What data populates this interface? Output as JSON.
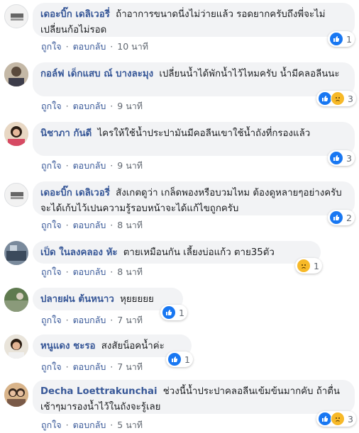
{
  "ui": {
    "like_label": "ถูกใจ",
    "reply_label": "ตอบกลับ",
    "separator": "·",
    "colors": {
      "author": "#385898",
      "bubble": "#f2f3f5",
      "meta": "#606770",
      "like": "#1877f2",
      "sad": "#f7b928"
    }
  },
  "comments": [
    {
      "author": "เดอะบิ๊ก เดลิเวอรี่",
      "text": "ถ้าอาการขนาดนี่งไม่ว่ายแล้ว รอดยากครับถึงพี่จะไม่เปลี่ยนก้อไม่รอด",
      "time": "10 นาที",
      "reactions": [
        "like-icon"
      ],
      "reaction_count": "1",
      "avatar": "brand-logo"
    },
    {
      "author": "กอล์ฟ เด็กแสบ ณ์ บางละมุง",
      "text": "เปลี่ยนน้ำได้พักน้ำไว้ไหมครับ น้ำมีคลอลีนนะ",
      "time": "9 นาที",
      "reactions": [
        "like-icon",
        "sad-icon"
      ],
      "reaction_count": "3",
      "avatar": "photo"
    },
    {
      "author": "นิชาภา กันดี",
      "text": "ไครให้ใช้น้ำประปามันมีคอลีนเขาใช้น้ำถังที่กรองแล้ว",
      "time": "9 นาที",
      "reactions": [
        "like-icon"
      ],
      "reaction_count": "3",
      "avatar": "photo"
    },
    {
      "author": "เดอะบิ๊ก เดลิเวอรี่",
      "text": "สังเกตดูว่า เกล็ดพองหรือบวมไหม ต้องดูหลายๆอย่างครับจะได้เก้บไว้เปนความรู้รอบหน้าจะได้แก้ไขถูกครับ",
      "time": "8 นาที",
      "reactions": [
        "like-icon"
      ],
      "reaction_count": "2",
      "avatar": "brand-logo"
    },
    {
      "author": "เป็ด ในลงคลอง หัะ",
      "text": "ตายเหมือนกัน เลี้ยงบ่อแก้ว ตาย35ตัว",
      "time": "8 นาที",
      "reactions": [
        "sad-icon"
      ],
      "reaction_count": "1",
      "avatar": "photo"
    },
    {
      "author": "ปลายฝน ต้นหนาว",
      "text": "หุยยยยย",
      "time": "7 นาที",
      "reactions": [
        "like-icon"
      ],
      "reaction_count": "1",
      "avatar": "photo"
    },
    {
      "author": "หนูแดง ชะรอ",
      "text": "สงสัยน็อคน้ำค่ะ",
      "time": "7 นาที",
      "reactions": [
        "like-icon"
      ],
      "reaction_count": "1",
      "avatar": "photo"
    },
    {
      "author": "Decha Loettrakunchai",
      "text": "ช่วงนี้น้ำประปาคลอลีนเข้มข้นมากคับ ถ้าตื่นเช้าๆมารองน้ำไว้ในถังจะรู้เลย",
      "time": "5 นาที",
      "reactions": [
        "like-icon",
        "sad-icon"
      ],
      "reaction_count": "3",
      "avatar": "photo"
    }
  ]
}
